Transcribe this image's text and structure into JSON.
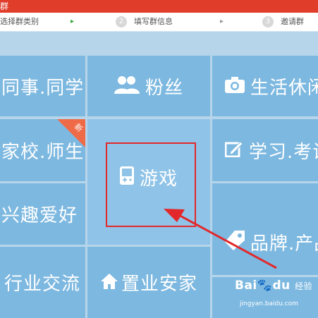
{
  "titlebar": {
    "title_fragment": "群"
  },
  "steps": [
    {
      "num": "",
      "label": "选择群类别"
    },
    {
      "num": "2",
      "label": "填写群信息"
    },
    {
      "num": "3",
      "label": "邀请群"
    }
  ],
  "step_arrow": "▸",
  "tiles": {
    "coworker": "同事.同学",
    "fans": "粉丝",
    "life": "生活休闲",
    "school": "家校.师生",
    "new_badge": "新",
    "game": "游戏",
    "study": "学习.考试",
    "hobby": "兴趣爱好",
    "brand": "品牌.产品",
    "industry": "行业交流",
    "realestate": "置业安家"
  },
  "watermark": {
    "brand": "Bai",
    "brand2": "du",
    "suffix": "经验",
    "url": "jingyan.baidu.com"
  },
  "colors": {
    "title_red": "#e03d2b",
    "tile_blue": "#7db8e0",
    "highlight_red": "#e2282a"
  }
}
